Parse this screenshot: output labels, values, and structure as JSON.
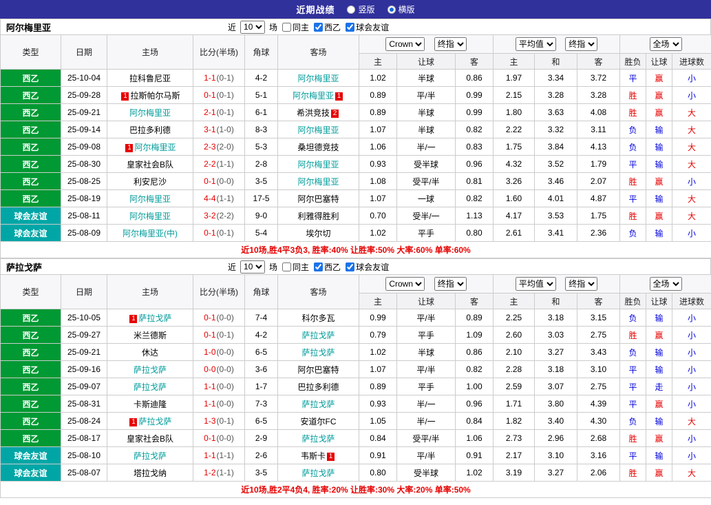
{
  "topbar": {
    "title": "近期战绩",
    "options": [
      {
        "label": "竖版",
        "checked": false
      },
      {
        "label": "横版",
        "checked": true
      }
    ]
  },
  "filter": {
    "near": "近",
    "count": "10",
    "games": "场",
    "same_home": "同主",
    "same_home_checked": false,
    "league": "西乙",
    "league_checked": true,
    "friendly": "球会友谊",
    "friendly_checked": true
  },
  "table_header": {
    "type": "类型",
    "date": "日期",
    "home": "主场",
    "score": "比分(半场)",
    "corner": "角球",
    "away": "客场",
    "selects": {
      "odds_source": "Crown",
      "final1": "终指",
      "avg": "平均值",
      "final2": "终指",
      "scope": "全场"
    },
    "sub": [
      "主",
      "让球",
      "客",
      "主",
      "和",
      "客",
      "胜负",
      "让球",
      "进球数"
    ]
  },
  "colors": {
    "vars": {
      "red": "#e60000",
      "blue": "#0000dd",
      "focus": "#009b9b",
      "topbar-bg": "#31319b",
      "accent": "#1a73e8"
    },
    "type": {
      "西乙": "#009933",
      "球会友谊": "#00a6a6"
    }
  },
  "sections": [
    {
      "team": "阿尔梅里亚",
      "rows": [
        {
          "type": "西乙",
          "date": "25-10-04",
          "home": "拉科鲁尼亚",
          "away": "阿尔梅里亚",
          "away_focus": true,
          "ft": "1-1",
          "ht": "(0-1)",
          "corner": "4-2",
          "odds": [
            "1.02",
            "半球",
            "0.86",
            "1.97",
            "3.34",
            "3.72"
          ],
          "res": [
            "平",
            "赢",
            "小"
          ],
          "res_c": [
            "blue",
            "red",
            "blue"
          ]
        },
        {
          "type": "西乙",
          "date": "25-09-28",
          "home": "拉斯帕尔马斯",
          "home_card": "1",
          "away": "阿尔梅里亚",
          "away_focus": true,
          "away_card": "1",
          "ft": "0-1",
          "ht": "(0-1)",
          "corner": "5-1",
          "odds": [
            "0.89",
            "平/半",
            "0.99",
            "2.15",
            "3.28",
            "3.28"
          ],
          "res": [
            "胜",
            "赢",
            "小"
          ],
          "res_c": [
            "red",
            "red",
            "blue"
          ]
        },
        {
          "type": "西乙",
          "date": "25-09-21",
          "home": "阿尔梅里亚",
          "home_focus": true,
          "away": "希洪竞技",
          "away_card": "2",
          "ft": "2-1",
          "ht": "(0-1)",
          "corner": "6-1",
          "odds": [
            "0.89",
            "半球",
            "0.99",
            "1.80",
            "3.63",
            "4.08"
          ],
          "res": [
            "胜",
            "赢",
            "大"
          ],
          "res_c": [
            "red",
            "red",
            "red"
          ]
        },
        {
          "type": "西乙",
          "date": "25-09-14",
          "home": "巴拉多利德",
          "away": "阿尔梅里亚",
          "away_focus": true,
          "ft": "3-1",
          "ht": "(1-0)",
          "corner": "8-3",
          "odds": [
            "1.07",
            "半球",
            "0.82",
            "2.22",
            "3.32",
            "3.11"
          ],
          "res": [
            "负",
            "输",
            "大"
          ],
          "res_c": [
            "blue",
            "blue",
            "red"
          ]
        },
        {
          "type": "西乙",
          "date": "25-09-08",
          "home": "阿尔梅里亚",
          "home_focus": true,
          "home_card": "1",
          "away": "桑坦德竞技",
          "ft": "2-3",
          "ht": "(2-0)",
          "corner": "5-3",
          "odds": [
            "1.06",
            "半/一",
            "0.83",
            "1.75",
            "3.84",
            "4.13"
          ],
          "res": [
            "负",
            "输",
            "大"
          ],
          "res_c": [
            "blue",
            "blue",
            "red"
          ]
        },
        {
          "type": "西乙",
          "date": "25-08-30",
          "home": "皇家社会B队",
          "away": "阿尔梅里亚",
          "away_focus": true,
          "ft": "2-2",
          "ht": "(1-1)",
          "corner": "2-8",
          "odds": [
            "0.93",
            "受半球",
            "0.96",
            "4.32",
            "3.52",
            "1.79"
          ],
          "res": [
            "平",
            "输",
            "大"
          ],
          "res_c": [
            "blue",
            "blue",
            "red"
          ]
        },
        {
          "type": "西乙",
          "date": "25-08-25",
          "home": "利安尼沙",
          "away": "阿尔梅里亚",
          "away_focus": true,
          "ft": "0-1",
          "ht": "(0-0)",
          "corner": "3-5",
          "odds": [
            "1.08",
            "受平/半",
            "0.81",
            "3.26",
            "3.46",
            "2.07"
          ],
          "res": [
            "胜",
            "赢",
            "小"
          ],
          "res_c": [
            "red",
            "red",
            "blue"
          ]
        },
        {
          "type": "西乙",
          "date": "25-08-19",
          "home": "阿尔梅里亚",
          "home_focus": true,
          "away": "阿尔巴塞特",
          "ft": "4-4",
          "ht": "(1-1)",
          "corner": "17-5",
          "odds": [
            "1.07",
            "一球",
            "0.82",
            "1.60",
            "4.01",
            "4.87"
          ],
          "res": [
            "平",
            "输",
            "大"
          ],
          "res_c": [
            "blue",
            "blue",
            "red"
          ]
        },
        {
          "type": "球会友谊",
          "date": "25-08-11",
          "home": "阿尔梅里亚",
          "home_focus": true,
          "away": "利雅得胜利",
          "ft": "3-2",
          "ht": "(2-2)",
          "corner": "9-0",
          "odds": [
            "0.70",
            "受半/一",
            "1.13",
            "4.17",
            "3.53",
            "1.75"
          ],
          "res": [
            "胜",
            "赢",
            "大"
          ],
          "res_c": [
            "red",
            "red",
            "red"
          ]
        },
        {
          "type": "球会友谊",
          "date": "25-08-09",
          "home": "阿尔梅里亚(中)",
          "home_focus": true,
          "away": "埃尔切",
          "ft": "0-1",
          "ht": "(0-1)",
          "corner": "5-4",
          "odds": [
            "1.02",
            "平手",
            "0.80",
            "2.61",
            "3.41",
            "2.36"
          ],
          "res": [
            "负",
            "输",
            "小"
          ],
          "res_c": [
            "blue",
            "blue",
            "blue"
          ]
        }
      ],
      "summary": "近10场,胜4平3负3, 胜率:40% 让胜率:50% 大率:60% 单率:60%"
    },
    {
      "team": "萨拉戈萨",
      "rows": [
        {
          "type": "西乙",
          "date": "25-10-05",
          "home": "萨拉戈萨",
          "home_focus": true,
          "home_card": "1",
          "away": "科尔多瓦",
          "ft": "0-1",
          "ht": "(0-0)",
          "corner": "7-4",
          "odds": [
            "0.99",
            "平/半",
            "0.89",
            "2.25",
            "3.18",
            "3.15"
          ],
          "res": [
            "负",
            "输",
            "小"
          ],
          "res_c": [
            "blue",
            "blue",
            "blue"
          ]
        },
        {
          "type": "西乙",
          "date": "25-09-27",
          "home": "米兰德斯",
          "away": "萨拉戈萨",
          "away_focus": true,
          "ft": "0-1",
          "ht": "(0-1)",
          "corner": "4-2",
          "odds": [
            "0.79",
            "平手",
            "1.09",
            "2.60",
            "3.03",
            "2.75"
          ],
          "res": [
            "胜",
            "赢",
            "小"
          ],
          "res_c": [
            "red",
            "red",
            "blue"
          ]
        },
        {
          "type": "西乙",
          "date": "25-09-21",
          "home": "休达",
          "away": "萨拉戈萨",
          "away_focus": true,
          "ft": "1-0",
          "ht": "(0-0)",
          "corner": "6-5",
          "odds": [
            "1.02",
            "半球",
            "0.86",
            "2.10",
            "3.27",
            "3.43"
          ],
          "res": [
            "负",
            "输",
            "小"
          ],
          "res_c": [
            "blue",
            "blue",
            "blue"
          ]
        },
        {
          "type": "西乙",
          "date": "25-09-16",
          "home": "萨拉戈萨",
          "home_focus": true,
          "away": "阿尔巴塞特",
          "ft": "0-0",
          "ht": "(0-0)",
          "corner": "3-6",
          "odds": [
            "1.07",
            "平/半",
            "0.82",
            "2.28",
            "3.18",
            "3.10"
          ],
          "res": [
            "平",
            "输",
            "小"
          ],
          "res_c": [
            "blue",
            "blue",
            "blue"
          ]
        },
        {
          "type": "西乙",
          "date": "25-09-07",
          "home": "萨拉戈萨",
          "home_focus": true,
          "away": "巴拉多利德",
          "ft": "1-1",
          "ht": "(0-0)",
          "corner": "1-7",
          "odds": [
            "0.89",
            "平手",
            "1.00",
            "2.59",
            "3.07",
            "2.75"
          ],
          "res": [
            "平",
            "走",
            "小"
          ],
          "res_c": [
            "blue",
            "blue",
            "blue"
          ]
        },
        {
          "type": "西乙",
          "date": "25-08-31",
          "home": "卡斯迪隆",
          "away": "萨拉戈萨",
          "away_focus": true,
          "ft": "1-1",
          "ht": "(0-0)",
          "corner": "7-3",
          "odds": [
            "0.93",
            "半/一",
            "0.96",
            "1.71",
            "3.80",
            "4.39"
          ],
          "res": [
            "平",
            "赢",
            "小"
          ],
          "res_c": [
            "blue",
            "red",
            "blue"
          ]
        },
        {
          "type": "西乙",
          "date": "25-08-24",
          "home": "萨拉戈萨",
          "home_focus": true,
          "home_card": "1",
          "away": "安道尔FC",
          "ft": "1-3",
          "ht": "(0-1)",
          "corner": "6-5",
          "odds": [
            "1.05",
            "半/一",
            "0.84",
            "1.82",
            "3.40",
            "4.30"
          ],
          "res": [
            "负",
            "输",
            "大"
          ],
          "res_c": [
            "blue",
            "blue",
            "red"
          ]
        },
        {
          "type": "西乙",
          "date": "25-08-17",
          "home": "皇家社会B队",
          "away": "萨拉戈萨",
          "away_focus": true,
          "ft": "0-1",
          "ht": "(0-0)",
          "corner": "2-9",
          "odds": [
            "0.84",
            "受平/半",
            "1.06",
            "2.73",
            "2.96",
            "2.68"
          ],
          "res": [
            "胜",
            "赢",
            "小"
          ],
          "res_c": [
            "red",
            "red",
            "blue"
          ]
        },
        {
          "type": "球会友谊",
          "date": "25-08-10",
          "home": "萨拉戈萨",
          "home_focus": true,
          "away": "韦斯卡",
          "away_card": "1",
          "ft": "1-1",
          "ht": "(1-1)",
          "corner": "2-6",
          "odds": [
            "0.91",
            "平/半",
            "0.91",
            "2.17",
            "3.10",
            "3.16"
          ],
          "res": [
            "平",
            "输",
            "小"
          ],
          "res_c": [
            "blue",
            "blue",
            "blue"
          ]
        },
        {
          "type": "球会友谊",
          "date": "25-08-07",
          "home": "塔拉戈纳",
          "away": "萨拉戈萨",
          "away_focus": true,
          "ft": "1-2",
          "ht": "(1-1)",
          "corner": "3-5",
          "odds": [
            "0.80",
            "受半球",
            "1.02",
            "3.19",
            "3.27",
            "2.06"
          ],
          "res": [
            "胜",
            "赢",
            "大"
          ],
          "res_c": [
            "red",
            "red",
            "red"
          ]
        }
      ],
      "summary": "近10场,胜2平4负4, 胜率:20% 让胜率:30% 大率:20% 单率:50%"
    }
  ]
}
